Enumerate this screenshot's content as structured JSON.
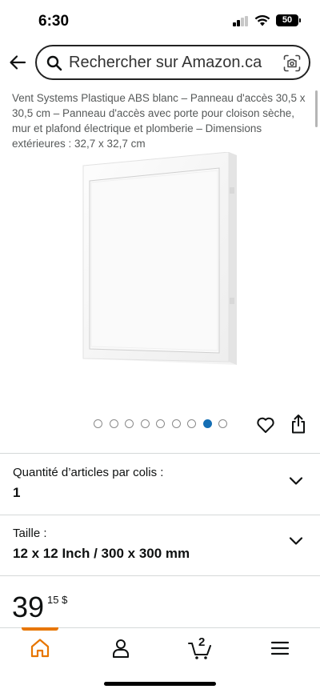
{
  "status_bar": {
    "time": "6:30",
    "battery": "50",
    "icons": [
      "cellular-signal-icon",
      "wifi-icon",
      "battery-icon"
    ]
  },
  "search": {
    "placeholder": "Rechercher sur Amazon.ca",
    "icons": [
      "back-arrow-icon",
      "search-icon",
      "camera-scan-icon"
    ]
  },
  "product": {
    "title": "Vent Systems Plastique ABS blanc – Panneau d'accès 30,5 x 30,5 cm – Panneau d'accès avec porte pour cloison sèche, mur et plafond électrique et plomberie – Dimensions extérieures : 32,7 x 32,7 cm"
  },
  "gallery": {
    "image_count": 9,
    "active_index": 7,
    "icons": [
      "heart-icon",
      "share-icon"
    ]
  },
  "options": {
    "quantity": {
      "label": "Quantité d’articles par colis :",
      "value": "1"
    },
    "size": {
      "label": "Taille :",
      "value": "12 x 12 Inch / 300 x 300 mm"
    }
  },
  "price": {
    "whole": "39",
    "fraction": "15 $"
  },
  "bottom_nav": {
    "items": [
      "home-icon",
      "account-icon",
      "cart-icon",
      "menu-icon"
    ],
    "cart_count": "2",
    "active": "home-icon"
  },
  "colors": {
    "accent_orange": "#e77600",
    "active_dot_blue": "#146eb4",
    "title_gray": "#565959",
    "text": "#0f1111"
  }
}
